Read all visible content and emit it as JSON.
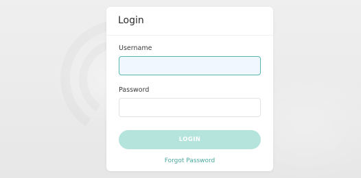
{
  "login": {
    "title": "Login",
    "username": {
      "label": "Username",
      "value": "",
      "placeholder": ""
    },
    "password": {
      "label": "Password",
      "value": "",
      "placeholder": ""
    },
    "submit_label": "LOGIN",
    "forgot_label": "Forgot Password"
  },
  "colors": {
    "accent": "#57b7ad",
    "button_disabled": "#b5e4dc",
    "link": "#4aa79d",
    "background": "#ececec",
    "card": "#ffffff"
  }
}
